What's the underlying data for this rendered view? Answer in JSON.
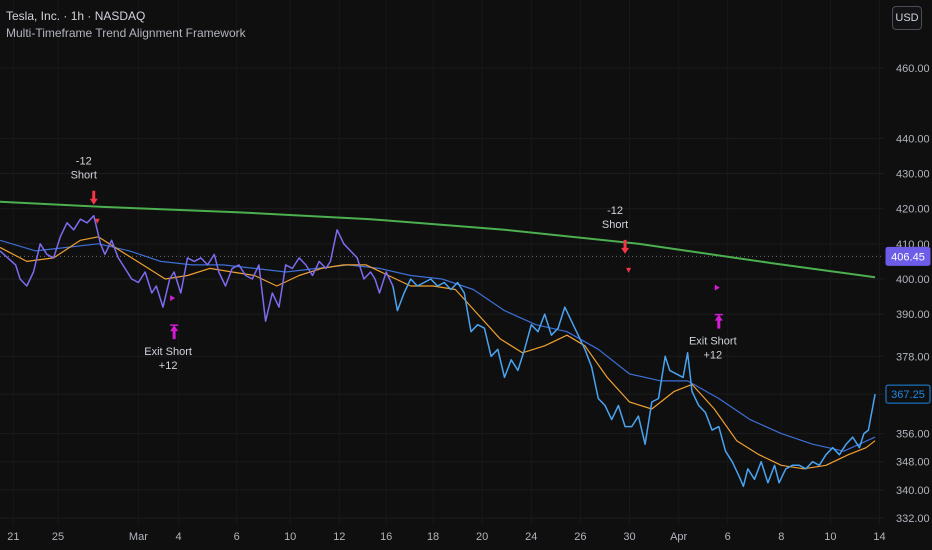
{
  "header": {
    "symbol": "Tesla, Inc. · 1h · NASDAQ",
    "indicator": "Multi-Timeframe Trend Alignment Framework"
  },
  "currency_button": "USD",
  "colors": {
    "price_purple": "#7b6cf0",
    "price_blue": "#4aa3f0",
    "ema_fast": "#f0a030",
    "ema_slow": "#3d6fd6",
    "long_ma": "#4caf50",
    "short_arrow": "#f23645",
    "exit_arrow": "#d31cd3",
    "price_tag_purple": "#6c5ce7",
    "price_tag_blue": "#1e88e5"
  },
  "price_tags": {
    "prev": "406.45",
    "last": "367.25"
  },
  "annotations": [
    {
      "id": "short-1",
      "kind": "short",
      "x": 1.8,
      "y": 420.0,
      "lines": [
        "-12",
        "Short"
      ]
    },
    {
      "id": "exit-1",
      "kind": "exit",
      "x": 3.6,
      "y": 388.0,
      "lines": [
        "Exit Short",
        "+12"
      ]
    },
    {
      "id": "short-2",
      "kind": "short",
      "x": 13.7,
      "y": 406.0,
      "lines": [
        "-12",
        "Short"
      ]
    },
    {
      "id": "exit-2",
      "kind": "exit",
      "x": 15.8,
      "y": 391.0,
      "lines": [
        "Exit Short",
        "+12"
      ]
    }
  ],
  "chart_data": {
    "type": "line",
    "ylim": [
      330,
      468
    ],
    "yticks": [
      332,
      340,
      348,
      356,
      367.25,
      378,
      390,
      400,
      410,
      420,
      430,
      440,
      460
    ],
    "ytick_labels": [
      "332.00",
      "340.00",
      "348.00",
      "356.00",
      "",
      "378.00",
      "390.00",
      "400.00",
      "410.00",
      "420.00",
      "430.00",
      "440.00",
      "460.00"
    ],
    "xticks": [
      {
        "x": 0,
        "label": "21"
      },
      {
        "x": 1,
        "label": "25"
      },
      {
        "x": 2.8,
        "label": "Mar"
      },
      {
        "x": 3.7,
        "label": "4"
      },
      {
        "x": 5,
        "label": "6"
      },
      {
        "x": 6.2,
        "label": "10"
      },
      {
        "x": 7.3,
        "label": "12"
      },
      {
        "x": 8.35,
        "label": "16"
      },
      {
        "x": 9.4,
        "label": "18"
      },
      {
        "x": 10.5,
        "label": "20"
      },
      {
        "x": 11.6,
        "label": "24"
      },
      {
        "x": 12.7,
        "label": "26"
      },
      {
        "x": 13.8,
        "label": "30"
      },
      {
        "x": 14.9,
        "label": "Apr"
      },
      {
        "x": 16,
        "label": "6"
      },
      {
        "x": 17.2,
        "label": "8"
      },
      {
        "x": 18.3,
        "label": "10"
      },
      {
        "x": 19.4,
        "label": "14"
      }
    ],
    "xlim": [
      -0.3,
      19.5
    ],
    "series": [
      {
        "key": "price_purple",
        "values": [
          [
            -0.3,
            408
          ],
          [
            0.05,
            404
          ],
          [
            0.15,
            400
          ],
          [
            0.3,
            398
          ],
          [
            0.45,
            402
          ],
          [
            0.6,
            410
          ],
          [
            0.75,
            407
          ],
          [
            0.9,
            406
          ],
          [
            1.05,
            412
          ],
          [
            1.2,
            416
          ],
          [
            1.35,
            414
          ],
          [
            1.5,
            417
          ],
          [
            1.65,
            416
          ],
          [
            1.8,
            418
          ],
          [
            1.95,
            410
          ],
          [
            2.05,
            407
          ],
          [
            2.2,
            411
          ],
          [
            2.35,
            406
          ],
          [
            2.5,
            403
          ],
          [
            2.65,
            400
          ],
          [
            2.8,
            399
          ],
          [
            2.95,
            402
          ],
          [
            3.1,
            396
          ],
          [
            3.2,
            398
          ],
          [
            3.35,
            392
          ],
          [
            3.5,
            400
          ],
          [
            3.6,
            402
          ],
          [
            3.75,
            396
          ],
          [
            3.9,
            406
          ],
          [
            4.05,
            405
          ],
          [
            4.2,
            406
          ],
          [
            4.35,
            404
          ],
          [
            4.5,
            407
          ],
          [
            4.6,
            402
          ],
          [
            4.75,
            398
          ],
          [
            4.9,
            403
          ],
          [
            5.05,
            404
          ],
          [
            5.2,
            401
          ],
          [
            5.35,
            400
          ],
          [
            5.5,
            404
          ],
          [
            5.65,
            388
          ],
          [
            5.8,
            396
          ],
          [
            5.95,
            392
          ],
          [
            6.1,
            404
          ],
          [
            6.25,
            403
          ],
          [
            6.4,
            406
          ],
          [
            6.55,
            404
          ],
          [
            6.7,
            401
          ],
          [
            6.85,
            405
          ],
          [
            7.0,
            403
          ],
          [
            7.1,
            405
          ],
          [
            7.25,
            414
          ],
          [
            7.4,
            410
          ],
          [
            7.55,
            408
          ],
          [
            7.7,
            406
          ],
          [
            7.85,
            400
          ],
          [
            8.0,
            402
          ],
          [
            8.1,
            400
          ],
          [
            8.2,
            396
          ],
          [
            8.35,
            402
          ],
          [
            8.5,
            398
          ]
        ]
      },
      {
        "key": "price_blue",
        "values": [
          [
            8.5,
            398
          ],
          [
            8.6,
            391
          ],
          [
            8.75,
            396
          ],
          [
            8.9,
            400
          ],
          [
            9.05,
            398
          ],
          [
            9.2,
            399
          ],
          [
            9.35,
            400
          ],
          [
            9.5,
            398
          ],
          [
            9.65,
            399
          ],
          [
            9.8,
            397
          ],
          [
            9.95,
            399
          ],
          [
            10.1,
            396
          ],
          [
            10.25,
            385
          ],
          [
            10.4,
            387
          ],
          [
            10.55,
            386
          ],
          [
            10.7,
            378
          ],
          [
            10.85,
            380
          ],
          [
            11.0,
            372
          ],
          [
            11.15,
            377
          ],
          [
            11.3,
            374
          ],
          [
            11.45,
            380
          ],
          [
            11.6,
            387
          ],
          [
            11.75,
            385
          ],
          [
            11.9,
            390
          ],
          [
            12.05,
            384
          ],
          [
            12.2,
            386
          ],
          [
            12.35,
            392
          ],
          [
            12.5,
            388
          ],
          [
            12.65,
            384
          ],
          [
            12.8,
            380
          ],
          [
            12.95,
            375
          ],
          [
            13.1,
            366
          ],
          [
            13.25,
            364
          ],
          [
            13.4,
            360
          ],
          [
            13.55,
            364
          ],
          [
            13.7,
            358
          ],
          [
            13.85,
            358
          ],
          [
            14.0,
            361
          ],
          [
            14.15,
            353
          ],
          [
            14.3,
            365
          ],
          [
            14.45,
            366
          ],
          [
            14.6,
            378
          ],
          [
            14.7,
            374
          ],
          [
            14.85,
            373
          ],
          [
            15.0,
            372
          ],
          [
            15.1,
            379
          ],
          [
            15.2,
            368
          ],
          [
            15.35,
            364
          ],
          [
            15.5,
            362
          ],
          [
            15.65,
            357
          ],
          [
            15.8,
            358
          ],
          [
            15.95,
            351
          ],
          [
            16.1,
            348
          ],
          [
            16.25,
            344
          ],
          [
            16.35,
            341
          ],
          [
            16.45,
            346
          ],
          [
            16.6,
            343
          ],
          [
            16.75,
            348
          ],
          [
            16.9,
            342
          ],
          [
            17.05,
            347
          ],
          [
            17.15,
            342
          ],
          [
            17.3,
            346
          ],
          [
            17.45,
            347
          ],
          [
            17.6,
            347
          ],
          [
            17.75,
            346
          ],
          [
            17.9,
            348
          ],
          [
            18.05,
            347
          ],
          [
            18.2,
            350
          ],
          [
            18.35,
            352
          ],
          [
            18.5,
            350
          ],
          [
            18.65,
            353
          ],
          [
            18.8,
            355
          ],
          [
            18.95,
            352
          ],
          [
            19.05,
            356
          ],
          [
            19.15,
            357
          ],
          [
            19.3,
            367.25
          ]
        ]
      },
      {
        "key": "ema_fast",
        "values": [
          [
            -0.3,
            409
          ],
          [
            0.3,
            405
          ],
          [
            0.9,
            406
          ],
          [
            1.5,
            411
          ],
          [
            1.9,
            412
          ],
          [
            2.4,
            408
          ],
          [
            2.9,
            404
          ],
          [
            3.4,
            400
          ],
          [
            3.9,
            401
          ],
          [
            4.4,
            403
          ],
          [
            4.9,
            402
          ],
          [
            5.4,
            401
          ],
          [
            5.9,
            398
          ],
          [
            6.4,
            401
          ],
          [
            6.9,
            403
          ],
          [
            7.4,
            404
          ],
          [
            7.9,
            404
          ],
          [
            8.4,
            401
          ],
          [
            8.9,
            398
          ],
          [
            9.4,
            398
          ],
          [
            9.9,
            397
          ],
          [
            10.4,
            390
          ],
          [
            10.9,
            383
          ],
          [
            11.4,
            379
          ],
          [
            11.9,
            381
          ],
          [
            12.4,
            384
          ],
          [
            12.8,
            381
          ],
          [
            13.3,
            372
          ],
          [
            13.8,
            365
          ],
          [
            14.3,
            363
          ],
          [
            14.8,
            368
          ],
          [
            15.2,
            370
          ],
          [
            15.7,
            363
          ],
          [
            16.2,
            354
          ],
          [
            16.7,
            350
          ],
          [
            17.2,
            347
          ],
          [
            17.7,
            346
          ],
          [
            18.2,
            347
          ],
          [
            18.7,
            350
          ],
          [
            19.1,
            352
          ],
          [
            19.3,
            354
          ]
        ]
      },
      {
        "key": "ema_slow",
        "values": [
          [
            -0.3,
            411
          ],
          [
            0.5,
            408
          ],
          [
            1.2,
            409
          ],
          [
            1.9,
            410
          ],
          [
            2.6,
            408
          ],
          [
            3.3,
            405
          ],
          [
            4.0,
            404
          ],
          [
            4.7,
            404
          ],
          [
            5.4,
            403
          ],
          [
            6.1,
            402
          ],
          [
            6.8,
            403
          ],
          [
            7.5,
            404
          ],
          [
            8.2,
            403
          ],
          [
            8.9,
            401
          ],
          [
            9.6,
            400
          ],
          [
            10.3,
            397
          ],
          [
            11.0,
            391
          ],
          [
            11.7,
            387
          ],
          [
            12.4,
            385
          ],
          [
            13.1,
            380
          ],
          [
            13.8,
            373
          ],
          [
            14.5,
            371
          ],
          [
            15.1,
            371
          ],
          [
            15.8,
            366
          ],
          [
            16.5,
            360
          ],
          [
            17.2,
            356
          ],
          [
            17.9,
            353
          ],
          [
            18.6,
            351
          ],
          [
            19.3,
            355
          ]
        ]
      },
      {
        "key": "long_ma",
        "values": [
          [
            -0.3,
            422
          ],
          [
            2,
            420.5
          ],
          [
            5,
            419
          ],
          [
            8,
            417
          ],
          [
            11,
            414
          ],
          [
            14,
            410
          ],
          [
            17,
            404.5
          ],
          [
            19.3,
            400.5
          ]
        ]
      }
    ]
  }
}
